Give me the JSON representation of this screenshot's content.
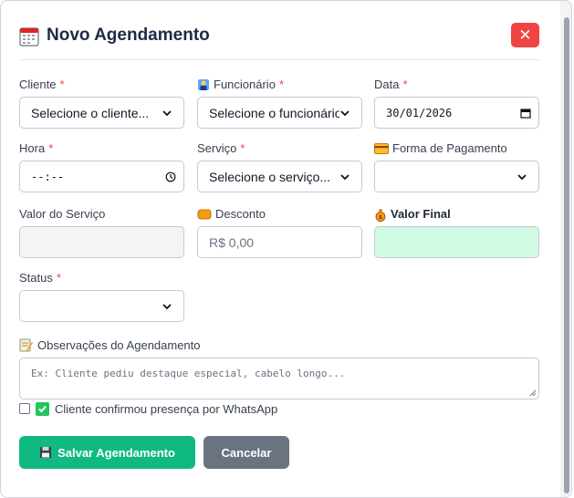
{
  "modal": {
    "title": "Novo Agendamento",
    "title_icon": "calendar-icon",
    "close_icon": "close-icon",
    "close_label": "✕"
  },
  "form": {
    "cliente": {
      "label": "Cliente",
      "required": "*",
      "value": "Selecione o cliente..."
    },
    "funcionario": {
      "label": "Funcionário",
      "required": "*",
      "icon": "employee-icon",
      "value": "Selecione o funcionário"
    },
    "data": {
      "label": "Data",
      "required": "*",
      "value": "30/01/2026",
      "icon": "calendar-picker-icon"
    },
    "hora": {
      "label": "Hora",
      "required": "*",
      "value": "--:--",
      "icon": "clock-icon"
    },
    "servico": {
      "label": "Serviço",
      "required": "*",
      "value": "Selecione o serviço..."
    },
    "forma_pagamento": {
      "label": "Forma de Pagamento",
      "icon": "credit-card-icon",
      "value": ""
    },
    "valor_servico": {
      "label": "Valor do Serviço",
      "value": ""
    },
    "desconto": {
      "label": "Desconto",
      "icon": "coin-icon",
      "placeholder": "R$ 0,00"
    },
    "valor_final": {
      "label": "Valor Final",
      "icon": "money-bag-icon",
      "value": ""
    },
    "status": {
      "label": "Status",
      "required": "*",
      "value": ""
    },
    "observacoes": {
      "label": "Observações do Agendamento",
      "icon": "memo-icon",
      "placeholder": "Ex: Cliente pediu destaque especial, cabelo longo..."
    },
    "whatsapp": {
      "label": "Cliente confirmou presença por WhatsApp",
      "checked": false,
      "icon": "green-check-icon"
    }
  },
  "buttons": {
    "save": {
      "label": "Salvar Agendamento",
      "icon": "floppy-disk-icon"
    },
    "cancel": {
      "label": "Cancelar"
    }
  },
  "colors": {
    "title": "#1f2a44",
    "required": "#ef4444",
    "close": "#ef4444",
    "save": "#10b981",
    "cancel": "#6b7280",
    "valor_final_bg": "#d1fae5"
  }
}
